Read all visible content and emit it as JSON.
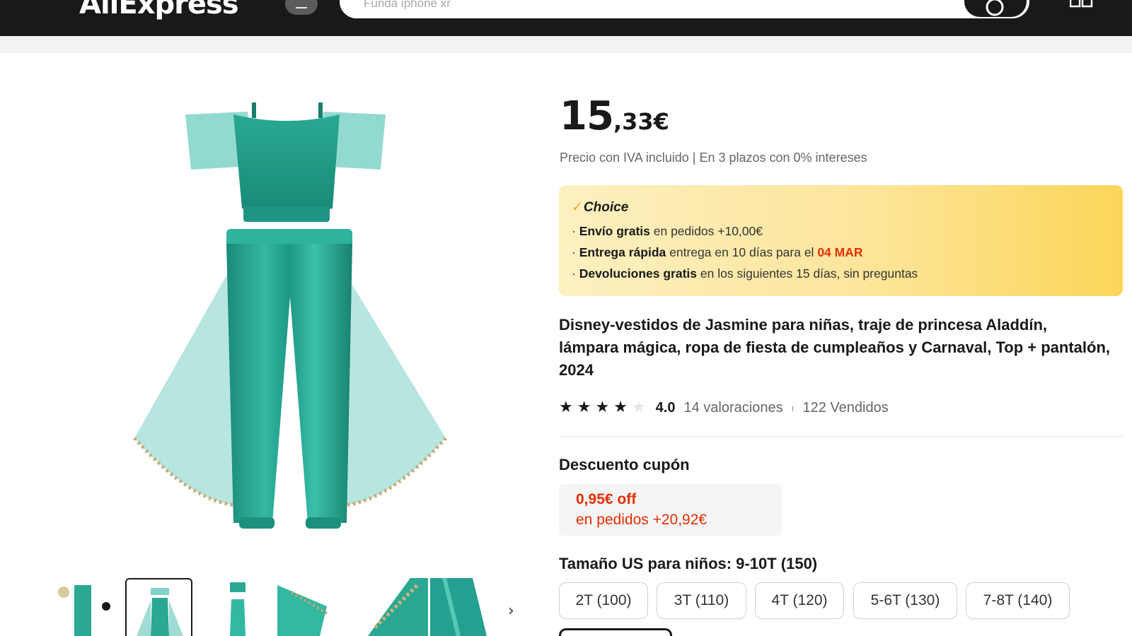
{
  "header": {
    "logo": "AliExpress",
    "search_placeholder": "Funda iphone xr",
    "icons": {
      "menu": "menu-icon",
      "search": "search-icon",
      "qr": "qr-code-icon"
    },
    "colors": {
      "bar": "#191919"
    }
  },
  "gallery": {
    "main_image": "jasmine-costume-teal",
    "thumbnails": [
      "thumb-1",
      "thumb-2",
      "thumb-3",
      "thumb-4",
      "thumb-5",
      "thumb-6"
    ],
    "selected_index": 1,
    "next_icon": "chevron-right-icon"
  },
  "product": {
    "price_int": "15",
    "price_dec": ",33€",
    "price_note": "Precio con IVA incluido | En 3 plazos con 0% intereses",
    "choice": {
      "label": "Choice",
      "line1_bold": "Envío gratis",
      "line1_rest": "en pedidos +10,00€",
      "line2_bold": "Entrega rápida",
      "line2_rest": "entrega en 10 días para el",
      "line2_date": "04 MAR",
      "line3_bold": "Devoluciones gratis",
      "line3_rest": "en los siguientes 15 días, sin preguntas"
    },
    "title": "Disney-vestidos de Jasmine para niñas, traje de princesa Aladdín, lámpara mágica, ropa de fiesta de cumpleaños y Carnaval, Top + pantalón, 2024",
    "rating": {
      "value": "4.0",
      "stars_filled": 4,
      "stars_total": 5,
      "reviews": "14 valoraciones",
      "separator": "ı",
      "sold": "122 Vendidos"
    },
    "coupon": {
      "label": "Descuento cupón",
      "off": "0,95€ off",
      "condition": "en pedidos +20,92€"
    },
    "size": {
      "label": "Tamaño US para niños: 9-10T (150)",
      "options": [
        "2T (100)",
        "3T (110)",
        "4T (120)",
        "5-6T (130)",
        "7-8T (140)"
      ]
    }
  },
  "colors": {
    "accent_red": "#e62e04",
    "choice_yellow": "#fde59a",
    "teal": "#23a08f"
  }
}
